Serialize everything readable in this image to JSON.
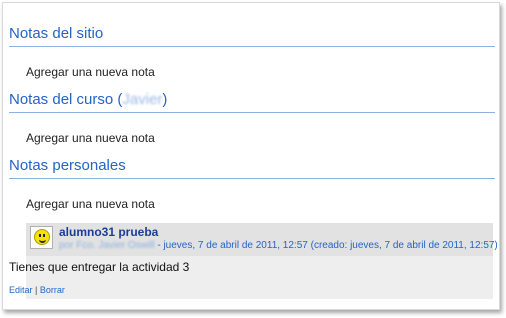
{
  "sections": [
    {
      "title": "Notas del sitio",
      "add_link": "Agregar una nueva nota"
    },
    {
      "title_prefix": "Notas del curso (",
      "title_blurred": "Javier",
      "title_suffix": ")",
      "add_link": "Agregar una nueva nota"
    },
    {
      "title": "Notas personales",
      "add_link": "Agregar una nueva nota"
    }
  ],
  "note": {
    "author": "alumno31 prueba",
    "by_blurred": "por Fco. Javier Oswill",
    "date": " - jueves, 7 de abril de 2011, 12:57 (creado: jueves, 7 de abril de 2011, 12:57)",
    "text": "Tienes que entregar la actividad 3",
    "edit_label": "Editar",
    "separator": " | ",
    "delete_label": "Borrar"
  },
  "colors": {
    "section_title": "#2464c4",
    "rule": "#8fb1e0",
    "note_bg": "#eeeeee"
  }
}
